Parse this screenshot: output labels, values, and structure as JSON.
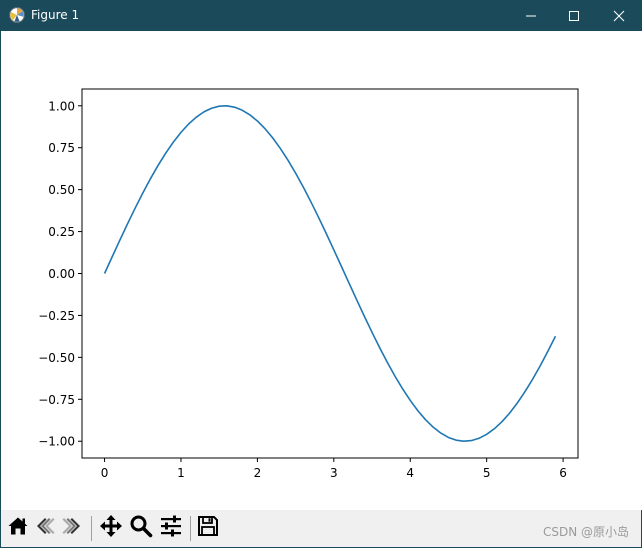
{
  "window": {
    "title": "Figure 1",
    "accent_color": "#1b4b5a",
    "controls": [
      {
        "icon": "minimize-icon"
      },
      {
        "icon": "maximize-icon"
      },
      {
        "icon": "close-icon"
      }
    ]
  },
  "toolbar": {
    "tools": [
      {
        "icon": "home-icon"
      },
      {
        "icon": "back-arrow-icon"
      },
      {
        "icon": "forward-arrow-icon"
      },
      {
        "icon": "pan-move-icon"
      },
      {
        "icon": "zoom-magnifier-icon"
      },
      {
        "icon": "configure-subplots-icon"
      },
      {
        "icon": "save-floppy-icon"
      }
    ],
    "watermark": "CSDN @原小岛"
  },
  "chart_data": {
    "type": "line",
    "function": "sin(x)",
    "x_start": 0,
    "x_end": 5.9,
    "x_step": 0.1,
    "xlim": [
      -0.295,
      6.195
    ],
    "ylim": [
      -1.1,
      1.1
    ],
    "x_ticks": [
      0,
      1,
      2,
      3,
      4,
      5,
      6
    ],
    "x_tick_labels": [
      "0",
      "1",
      "2",
      "3",
      "4",
      "5",
      "6"
    ],
    "y_ticks": [
      1.0,
      0.75,
      0.5,
      0.25,
      0.0,
      -0.25,
      -0.5,
      -0.75,
      -1.0
    ],
    "y_tick_labels": [
      "1.00",
      "0.75",
      "0.50",
      "0.25",
      "0.00",
      "−0.25",
      "−0.50",
      "−0.75",
      "−1.00"
    ],
    "grid": false,
    "series": [
      {
        "color": "#1f77b4",
        "x": [
          0.0,
          0.1,
          0.2,
          0.3,
          0.4,
          0.5,
          0.6,
          0.7,
          0.8,
          0.9,
          1.0,
          1.1,
          1.2,
          1.3,
          1.4,
          1.5,
          1.6,
          1.7,
          1.8,
          1.9,
          2.0,
          2.1,
          2.2,
          2.3,
          2.4,
          2.5,
          2.6,
          2.7,
          2.8,
          2.9,
          3.0,
          3.1,
          3.2,
          3.3,
          3.4,
          3.5,
          3.6,
          3.7,
          3.8,
          3.9,
          4.0,
          4.1,
          4.2,
          4.3,
          4.4,
          4.5,
          4.6,
          4.7,
          4.8,
          4.9,
          5.0,
          5.1,
          5.2,
          5.3,
          5.4,
          5.5,
          5.6,
          5.7,
          5.8,
          5.9
        ],
        "y": [
          0.0,
          0.0998,
          0.1987,
          0.2955,
          0.3894,
          0.4794,
          0.5646,
          0.6442,
          0.7174,
          0.7833,
          0.8415,
          0.8912,
          0.932,
          0.9636,
          0.9854,
          0.9975,
          0.9996,
          0.9917,
          0.9738,
          0.9463,
          0.9093,
          0.8632,
          0.8085,
          0.7457,
          0.6755,
          0.5985,
          0.5155,
          0.4274,
          0.335,
          0.2392,
          0.1411,
          0.0416,
          -0.0584,
          -0.1577,
          -0.2555,
          -0.3508,
          -0.4425,
          -0.5298,
          -0.6119,
          -0.6878,
          -0.7568,
          -0.8183,
          -0.8716,
          -0.9162,
          -0.9516,
          -0.9775,
          -0.9937,
          -0.9999,
          -0.9962,
          -0.9825,
          -0.9589,
          -0.9258,
          -0.8835,
          -0.8323,
          -0.7728,
          -0.7055,
          -0.6313,
          -0.5507,
          -0.4646,
          -0.3739
        ]
      }
    ]
  }
}
